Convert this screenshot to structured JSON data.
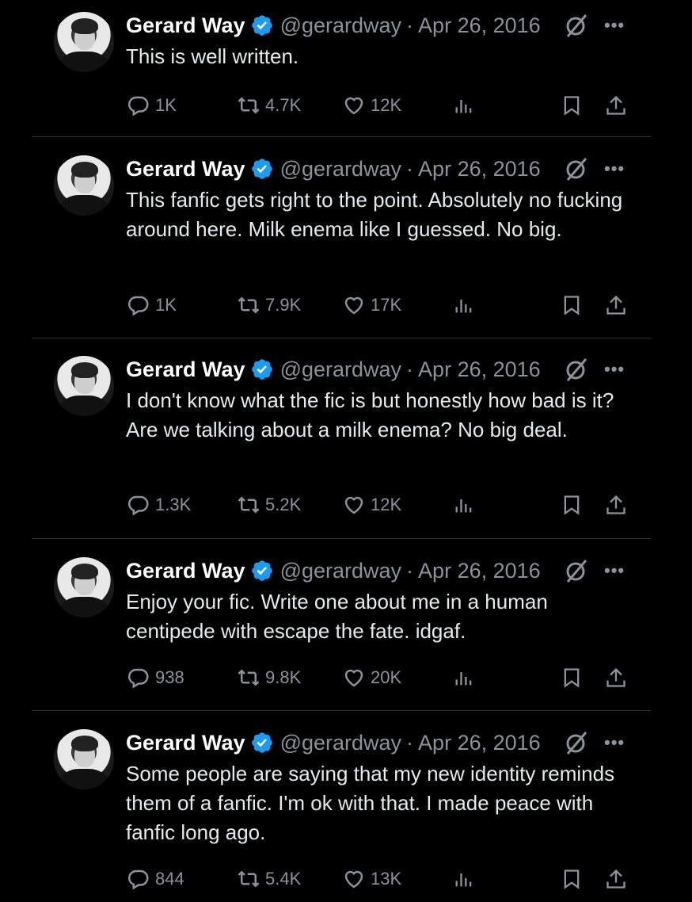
{
  "tweets": [
    {
      "name": "Gerard Way",
      "handle": "@gerardway",
      "date": "Apr 26, 2016",
      "text": "This is well written.",
      "replies": "1K",
      "retweets": "4.7K",
      "likes": "12K"
    },
    {
      "name": "Gerard Way",
      "handle": "@gerardway",
      "date": "Apr 26, 2016",
      "text": "This fanfic gets right to the point. Absolutely no fucking around here. Milk enema like I guessed. No big.",
      "replies": "1K",
      "retweets": "7.9K",
      "likes": "17K"
    },
    {
      "name": "Gerard Way",
      "handle": "@gerardway",
      "date": "Apr 26, 2016",
      "text": "I don't know what the fic is but honestly how bad is it? Are we talking about a milk enema? No big deal.",
      "replies": "1.3K",
      "retweets": "5.2K",
      "likes": "12K"
    },
    {
      "name": "Gerard Way",
      "handle": "@gerardway",
      "date": "Apr 26, 2016",
      "text": "Enjoy your fic. Write one about me in a human centipede with escape the fate. idgaf.",
      "replies": "938",
      "retweets": "9.8K",
      "likes": "20K"
    },
    {
      "name": "Gerard Way",
      "handle": "@gerardway",
      "date": "Apr 26, 2016",
      "text": "Some people are saying that my new identity reminds them of a fanfic. I'm ok with that. I made peace with fanfic long ago.",
      "replies": "844",
      "retweets": "5.4K",
      "likes": "13K"
    }
  ],
  "separator_dot": "·",
  "more_glyph": "•••",
  "colors": {
    "background": "#000000",
    "text": "#e7e9ea",
    "muted": "#8b9298",
    "verified": "#1d9bf0",
    "separator": "#2f3336"
  }
}
